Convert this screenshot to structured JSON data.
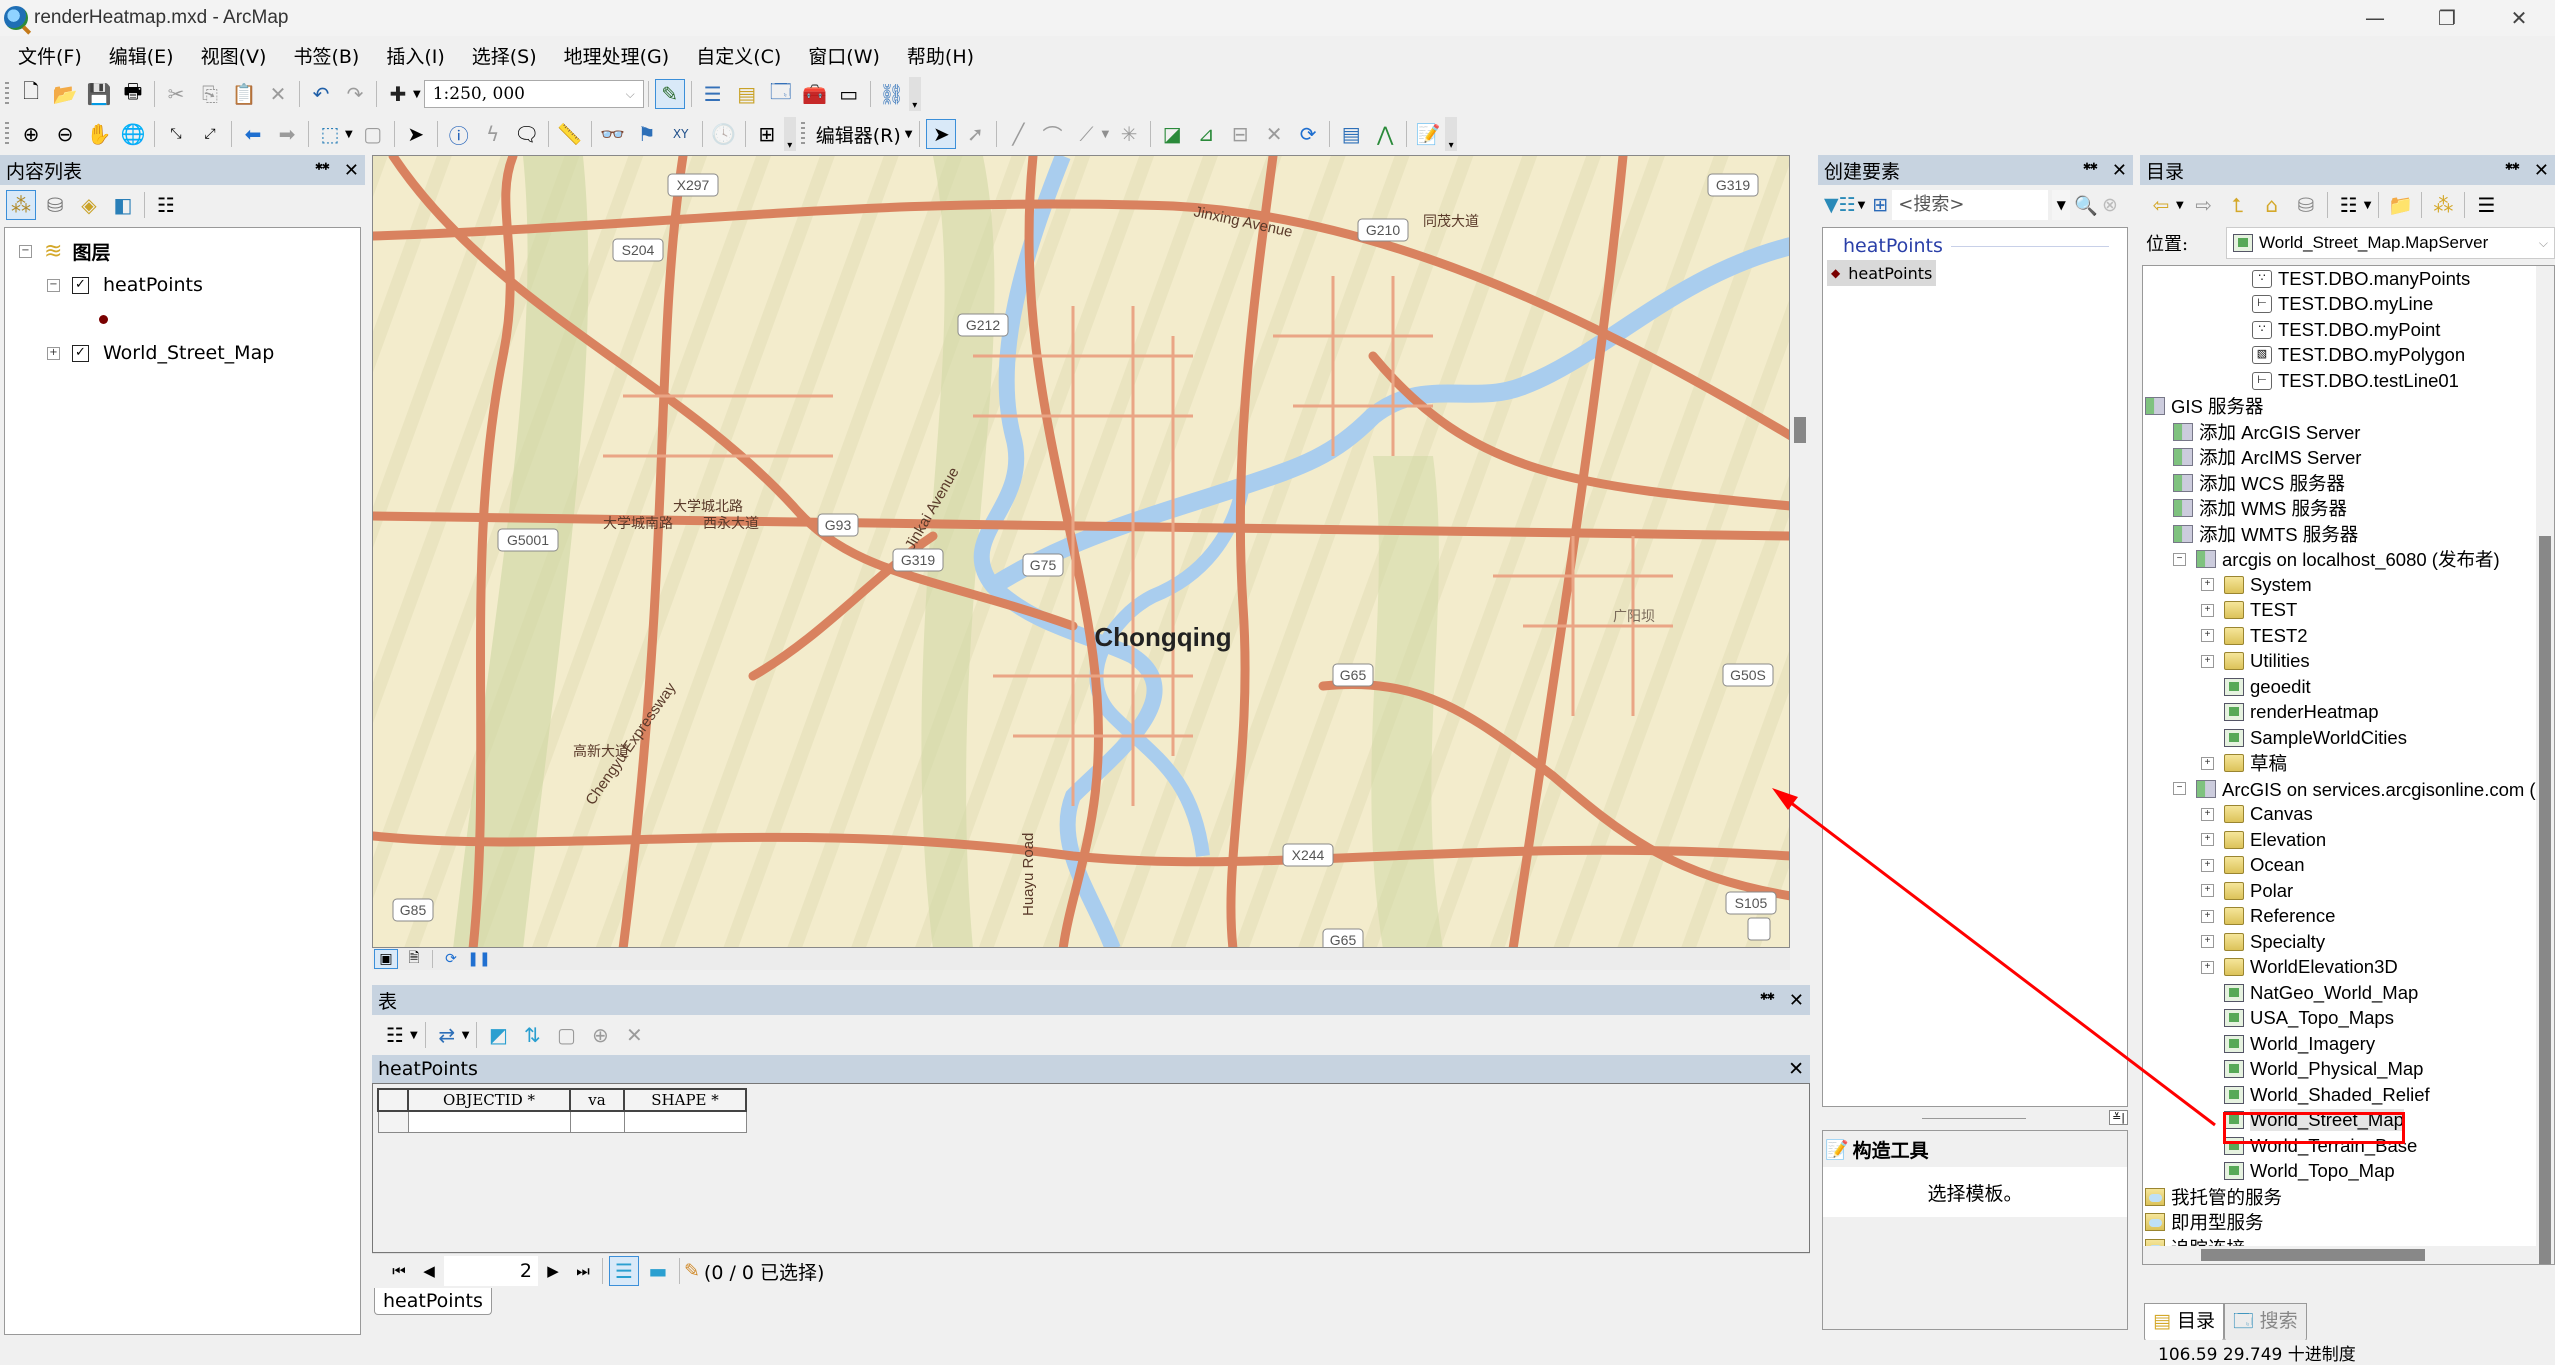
{
  "window": {
    "title": "renderHeatmap.mxd - ArcMap",
    "controls": {
      "minimize": "—",
      "restore": "❐",
      "close": "✕"
    }
  },
  "menu": [
    "文件(F)",
    "编辑(E)",
    "视图(V)",
    "书签(B)",
    "插入(I)",
    "选择(S)",
    "地理处理(G)",
    "自定义(C)",
    "窗口(W)",
    "帮助(H)"
  ],
  "toolbar": {
    "scale": "1:250, 000",
    "editor_label": "编辑器(R)"
  },
  "toc": {
    "title": "内容列表",
    "root": "图层",
    "layers": [
      {
        "name": "heatPoints",
        "checked": true,
        "expanded": true,
        "symbol_color": "#7a0000"
      },
      {
        "name": "World_Street_Map",
        "checked": true,
        "expanded": false
      }
    ]
  },
  "map": {
    "city_label": "Chongqing",
    "shields": [
      "X297",
      "S204",
      "G212",
      "G210",
      "G319",
      "G5001",
      "G93",
      "G319",
      "G75",
      "G65",
      "G50S",
      "X244",
      "G85",
      "S105",
      "G65"
    ],
    "road_labels": [
      "Jinxing Avenue",
      "Jinkai Avenue",
      "Chengyu Expressway",
      "Huayu Road",
      "同茂大道",
      "大学城北路",
      "大学城南路",
      "西永大道",
      "高新大道",
      "广阳坝"
    ],
    "water_color": "#a9cdee",
    "road_color": "#d9825f",
    "land_color": "#f3eccc"
  },
  "table": {
    "title": "表",
    "layer_name": "heatPoints",
    "columns": [
      "OBJECTID *",
      "va",
      "SHAPE *"
    ],
    "rows": [
      [
        "",
        "",
        ""
      ]
    ],
    "page": "2",
    "selection_status": "(0 / 0 已选择)",
    "tab_label": "heatPoints"
  },
  "create_features": {
    "title": "创建要素",
    "search_placeholder": "<搜索>",
    "group_label": "heatPoints",
    "template": "heatPoints",
    "construct_title": "构造工具",
    "construct_hint": "选择模板。"
  },
  "catalog": {
    "title": "目录",
    "location_label": "位置:",
    "location_value": "World_Street_Map.MapServer",
    "items": [
      {
        "label": "TEST.DBO.manyPoints",
        "indent": 3,
        "icon": "point-fc",
        "glyph": "∵"
      },
      {
        "label": "TEST.DBO.myLine",
        "indent": 3,
        "icon": "line-fc",
        "glyph": "⊢"
      },
      {
        "label": "TEST.DBO.myPoint",
        "indent": 3,
        "icon": "point-fc",
        "glyph": "∵"
      },
      {
        "label": "TEST.DBO.myPolygon",
        "indent": 3,
        "icon": "polygon-fc",
        "glyph": "▧"
      },
      {
        "label": "TEST.DBO.testLine01",
        "indent": 3,
        "icon": "line-fc",
        "glyph": "⊢"
      },
      {
        "label": "GIS 服务器",
        "indent": 0,
        "icon": "server-group"
      },
      {
        "label": "添加 ArcGIS Server",
        "indent": 1,
        "icon": "add-server"
      },
      {
        "label": "添加 ArcIMS Server",
        "indent": 1,
        "icon": "add-server"
      },
      {
        "label": "添加 WCS 服务器",
        "indent": 1,
        "icon": "add-server"
      },
      {
        "label": "添加 WMS 服务器",
        "indent": 1,
        "icon": "add-server"
      },
      {
        "label": "添加 WMTS 服务器",
        "indent": 1,
        "icon": "add-server"
      },
      {
        "label": "arcgis on localhost_6080 (发布者)",
        "indent": 1,
        "icon": "server",
        "expander": "−"
      },
      {
        "label": "System",
        "indent": 2,
        "icon": "folder",
        "expander": "+"
      },
      {
        "label": "TEST",
        "indent": 2,
        "icon": "folder",
        "expander": "+"
      },
      {
        "label": "TEST2",
        "indent": 2,
        "icon": "folder",
        "expander": "+"
      },
      {
        "label": "Utilities",
        "indent": 2,
        "icon": "folder",
        "expander": "+"
      },
      {
        "label": "geoedit",
        "indent": 2,
        "icon": "map-service"
      },
      {
        "label": "renderHeatmap",
        "indent": 2,
        "icon": "map-service"
      },
      {
        "label": "SampleWorldCities",
        "indent": 2,
        "icon": "map-service"
      },
      {
        "label": "草稿",
        "indent": 2,
        "icon": "folder",
        "expander": "+"
      },
      {
        "label": "ArcGIS on services.arcgisonline.com (用户)",
        "indent": 1,
        "icon": "server",
        "expander": "−"
      },
      {
        "label": "Canvas",
        "indent": 2,
        "icon": "folder",
        "expander": "+"
      },
      {
        "label": "Elevation",
        "indent": 2,
        "icon": "folder",
        "expander": "+"
      },
      {
        "label": "Ocean",
        "indent": 2,
        "icon": "folder",
        "expander": "+"
      },
      {
        "label": "Polar",
        "indent": 2,
        "icon": "folder",
        "expander": "+"
      },
      {
        "label": "Reference",
        "indent": 2,
        "icon": "folder",
        "expander": "+"
      },
      {
        "label": "Specialty",
        "indent": 2,
        "icon": "folder",
        "expander": "+"
      },
      {
        "label": "WorldElevation3D",
        "indent": 2,
        "icon": "folder",
        "expander": "+"
      },
      {
        "label": "NatGeo_World_Map",
        "indent": 2,
        "icon": "map-service"
      },
      {
        "label": "USA_Topo_Maps",
        "indent": 2,
        "icon": "map-service"
      },
      {
        "label": "World_Imagery",
        "indent": 2,
        "icon": "map-service"
      },
      {
        "label": "World_Physical_Map",
        "indent": 2,
        "icon": "map-service"
      },
      {
        "label": "World_Shaded_Relief",
        "indent": 2,
        "icon": "map-service"
      },
      {
        "label": "World_Street_Map",
        "indent": 2,
        "icon": "map-service",
        "selected": true,
        "highlighted": true
      },
      {
        "label": "World_Terrain_Base",
        "indent": 2,
        "icon": "map-service"
      },
      {
        "label": "World_Topo_Map",
        "indent": 2,
        "icon": "map-service"
      },
      {
        "label": "我托管的服务",
        "indent": 0,
        "icon": "cloud-folder"
      },
      {
        "label": "即用型服务",
        "indent": 0,
        "icon": "cloud-folder"
      },
      {
        "label": "追踪连接",
        "indent": 0,
        "icon": "tracking-folder"
      }
    ],
    "tabs": [
      {
        "label": "目录",
        "active": true
      },
      {
        "label": "搜索",
        "active": false
      }
    ]
  },
  "status": {
    "coordinates": "106.59  29.749 十进制度"
  },
  "annotation": {
    "color": "#ff0000",
    "note": "red arrow from highlighted World_Street_Map catalog item pointing to the map"
  }
}
